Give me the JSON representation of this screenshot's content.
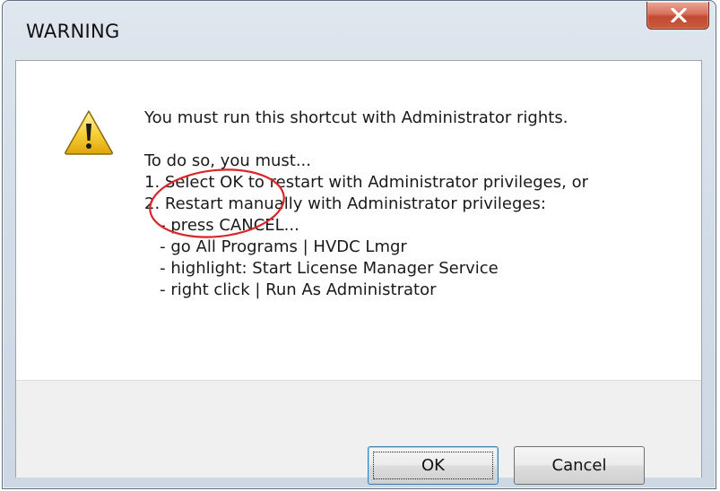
{
  "dialog": {
    "title": "WARNING",
    "message_lines": [
      "You must run this shortcut with Administrator rights.",
      "",
      "To do so, you must...",
      "1. Select OK to restart with Administrator privileges, or",
      "2. Restart manually with Administrator privileges:",
      "   - press CANCEL...",
      "   - go All Programs | HVDC Lmgr",
      "   - highlight: Start License Manager Service",
      "   - right click | Run As Administrator"
    ],
    "buttons": {
      "ok_label": "OK",
      "cancel_label": "Cancel"
    },
    "icons": {
      "message_icon": "warning-icon",
      "close_icon": "close-icon"
    },
    "colors": {
      "annotation_circle": "#d9262c",
      "close_button": "#c95b3f",
      "warning_yellow": "#f5c518"
    }
  }
}
